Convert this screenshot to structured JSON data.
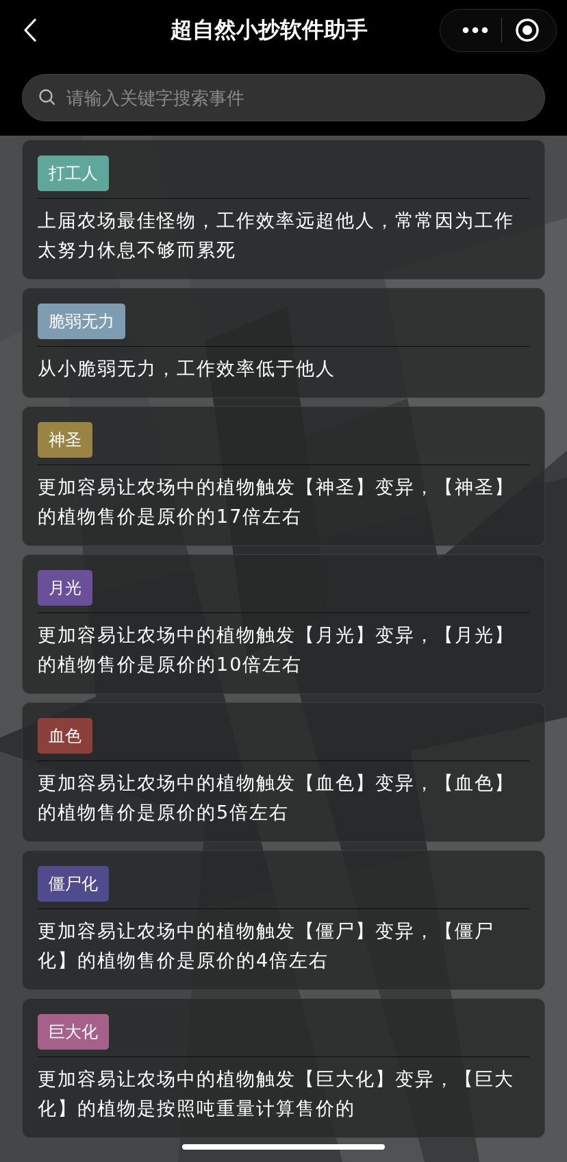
{
  "header": {
    "title": "超自然小抄软件助手"
  },
  "search": {
    "placeholder": "请输入关键字搜索事件"
  },
  "traits": [
    {
      "tag": "打工人",
      "color": "#5fa79a",
      "description": "上届农场最佳怪物，工作效率远超他人，常常因为工作太努力休息不够而累死"
    },
    {
      "tag": "脆弱无力",
      "color": "#7f9db2",
      "description": "从小脆弱无力，工作效率低于他人"
    },
    {
      "tag": "神圣",
      "color": "#9a8444",
      "description": "更加容易让农场中的植物触发【神圣】变异，【神圣】的植物售价是原价的17倍左右"
    },
    {
      "tag": "月光",
      "color": "#6a4f9b",
      "description": "更加容易让农场中的植物触发【月光】变异，【月光】的植物售价是原价的10倍左右"
    },
    {
      "tag": "血色",
      "color": "#8b403b",
      "description": "更加容易让农场中的植物触发【血色】变异，【血色】的植物售价是原价的5倍左右"
    },
    {
      "tag": "僵尸化",
      "color": "#4f4b8c",
      "description": "更加容易让农场中的植物触发【僵尸】变异，【僵尸化】的植物售价是原价的4倍左右"
    },
    {
      "tag": "巨大化",
      "color": "#a6618b",
      "description": "更加容易让农场中的植物触发【巨大化】变异，【巨大化】的植物是按照吨重量计算售价的"
    }
  ]
}
